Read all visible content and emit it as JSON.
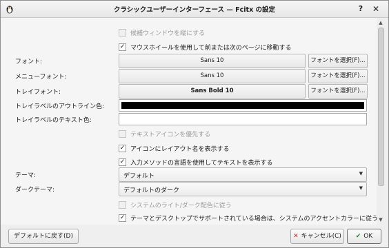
{
  "window": {
    "title": "クラシックユーザーインターフェース — Fcitx の設定",
    "help_glyph": "?",
    "close_glyph": "✕"
  },
  "options": {
    "vertical_candidate": {
      "label": "候補ウィンドウを縦にする",
      "checked": false
    },
    "mouse_wheel": {
      "label": "マウスホイールを使用して前または次のページに移動する",
      "checked": true
    },
    "prefer_text_icon": {
      "label": "テキストアイコンを優先する",
      "checked": false
    },
    "show_layout_name": {
      "label": "アイコンにレイアウト名を表示する",
      "checked": true
    },
    "show_language_text": {
      "label": "入力メソッドの言語を使用してテキストを表示する",
      "checked": true
    },
    "follow_system_dark": {
      "label": "システムのライト/ダーク配色に従う",
      "checked": false
    },
    "accent_color": {
      "label": "テーマとデスクトップでサポートされている場合は、システムのアクセントカラーに従う",
      "checked": true
    }
  },
  "fonts": {
    "font": {
      "label": "フォント:",
      "value": "Sans 10"
    },
    "menu_font": {
      "label": "メニューフォント:",
      "value": "Sans 10"
    },
    "tray_font": {
      "label": "トレイフォント:",
      "value": "Sans Bold 10"
    },
    "select_label": "フォントを選択(F)..."
  },
  "tray": {
    "outline_label": "トレイラベルのアウトライン色:",
    "outline_color": "#000000",
    "text_label": "トレイラベルのテキスト色:",
    "text_color": "#ffffff"
  },
  "theme": {
    "label": "テーマ:",
    "value": "デフォルト"
  },
  "dark_theme": {
    "label": "ダークテーマ:",
    "value": "デフォルトのダーク"
  },
  "buttons": {
    "defaults": "デフォルトに戻す(D)",
    "cancel": "キャンセル(C)",
    "ok": "OK"
  },
  "check_glyph": "✓",
  "arrow_glyph": "▼"
}
